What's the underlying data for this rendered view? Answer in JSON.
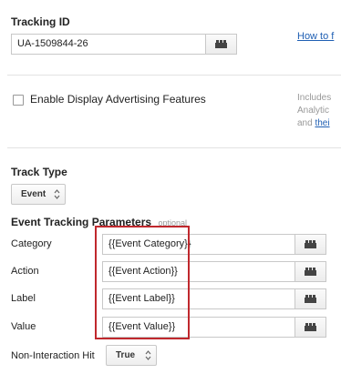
{
  "tracking": {
    "title": "Tracking ID",
    "value": "UA-1509844-26",
    "howto_link": "How to f"
  },
  "display_ads": {
    "label": "Enable Display Advertising Features",
    "checked": false,
    "side_line1": "Includes",
    "side_line2": "Analytic",
    "side_line3_prefix": "and ",
    "side_line3_link": "thei"
  },
  "track_type": {
    "title": "Track Type",
    "selected": "Event"
  },
  "event_params": {
    "title": "Event Tracking Parameters",
    "optional_label": "optional",
    "rows": [
      {
        "label": "Category",
        "value": "{{Event Category}}"
      },
      {
        "label": "Action",
        "value": "{{Event Action}}"
      },
      {
        "label": "Label",
        "value": "{{Event Label}}"
      },
      {
        "label": "Value",
        "value": "{{Event Value}}"
      }
    ],
    "non_interaction": {
      "label": "Non-Interaction Hit",
      "selected": "True"
    }
  },
  "colors": {
    "highlight": "#c0282d",
    "link": "#1f5fb3"
  }
}
